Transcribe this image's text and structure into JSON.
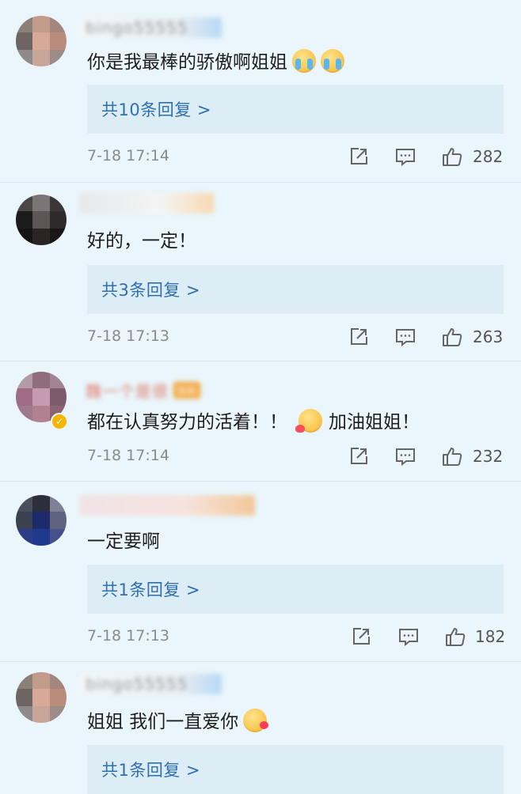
{
  "comments": [
    {
      "username": "bingo55555",
      "fan_badge": "",
      "text": "你是我最棒的骄傲啊姐姐",
      "reply_label": "共10条回复 >",
      "time": "7-18 17:14",
      "likes": "282"
    },
    {
      "username": "",
      "fan_badge": "",
      "text": "好的，一定！",
      "reply_label": "共3条回复 >",
      "time": "7-18 17:13",
      "likes": "263"
    },
    {
      "username": "魏一个是很",
      "fan_badge": "铁粉",
      "text": "都在认真努力的活着！！",
      "text_after_emoji": "加油姐姐！",
      "reply_label": "",
      "time": "7-18 17:14",
      "likes": "232"
    },
    {
      "username": "",
      "fan_badge": "",
      "text": "一定要啊",
      "reply_label": "共1条回复 >",
      "time": "7-18 17:13",
      "likes": "182"
    },
    {
      "username": "bingo55555",
      "fan_badge": "",
      "text": "姐姐 我们一直爱你",
      "reply_label": "共1条回复 >",
      "time": "",
      "likes": ""
    }
  ],
  "icons": {
    "share": "share-icon",
    "comment": "comment-icon",
    "like": "thumbs-up-icon",
    "verified": "verified-badge-icon"
  },
  "colors": {
    "background": "#eaf6fb",
    "reply_box": "#dcedf6",
    "reply_text": "#2f6fb0",
    "meta_text": "#8a8a8a",
    "verified": "#f7b500"
  }
}
